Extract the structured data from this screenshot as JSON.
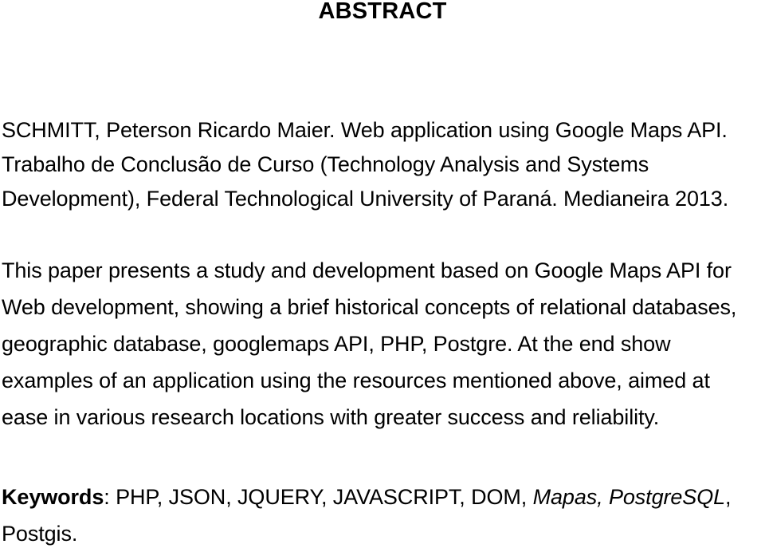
{
  "document": {
    "heading": "ABSTRACT",
    "reference": {
      "lines": [
        "SCHMITT, Peterson Ricardo Maier. Web application using Google Maps API.",
        "Trabalho de Conclusão de Curso (Technology Analysis and Systems",
        "Development), Federal Technological University of Paraná. Medianeira 2013."
      ],
      "full_text": "SCHMITT, Peterson Ricardo Maier. Web application using Google Maps API. Trabalho de Conclusão de Curso (Technology Analysis and Systems Development), Federal Technological University of Paraná. Medianeira 2013."
    },
    "abstract": {
      "lines": [
        "This paper presents a study and development based on Google Maps API for",
        "Web development, showing a brief historical concepts of relational databases,",
        "geographic database, googlemaps API, PHP, Postgre. At the end show",
        "examples of an application using the resources mentioned above, aimed at",
        "ease in various research locations with greater success and reliability."
      ],
      "full_text": "This paper presents a study and development based on Google Maps API for Web development, showing a brief historical concepts of relational databases, geographic database, googlemaps API, PHP, Postgre. At the end show examples of an application using the resources mentioned above, aimed at ease in various research locations with greater success and reliability."
    },
    "keywords": {
      "label": "Keywords",
      "separator": ": ",
      "plain_terms": "PHP, JSON, JQUERY, JAVASCRIPT, DOM, ",
      "italic_terms": "Mapas, PostgreSQL",
      "trailing": ",",
      "second_line": "Postgis.",
      "full_text": "Keywords: PHP, JSON, JQUERY, JAVASCRIPT, DOM, Mapas, PostgreSQL, Postgis."
    }
  },
  "style": {
    "text_color": "#000000",
    "background_color": "#ffffff"
  }
}
